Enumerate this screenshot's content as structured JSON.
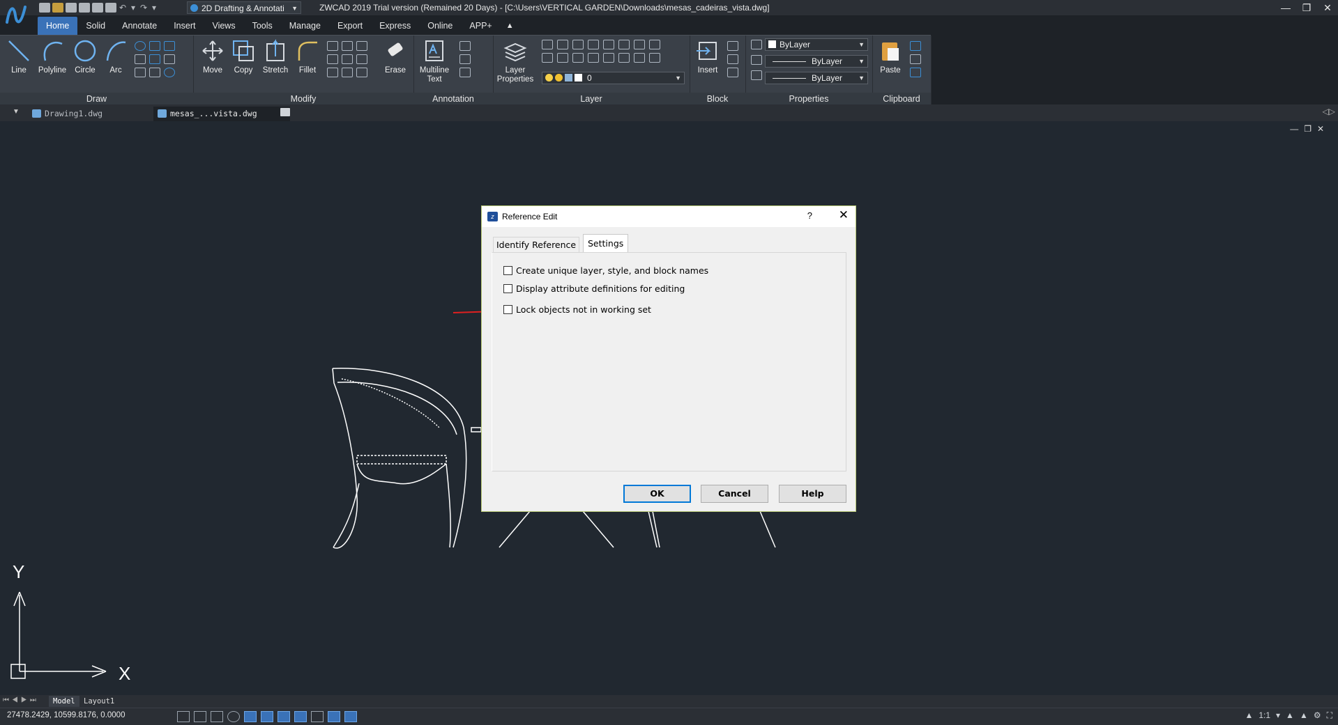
{
  "titlebar": {
    "workspace": "2D Drafting & Annotati",
    "window_title": "ZWCAD 2019 Trial version (Remained 20 Days) - [C:\\Users\\VERTICAL GARDEN\\Downloads\\mesas_cadeiras_vista.dwg]"
  },
  "ribbon_tabs": [
    "Home",
    "Solid",
    "Annotate",
    "Insert",
    "Views",
    "Tools",
    "Manage",
    "Export",
    "Express",
    "Online",
    "APP+"
  ],
  "ribbon": {
    "draw": {
      "title": "Draw",
      "line": "Line",
      "polyline": "Polyline",
      "circle": "Circle",
      "arc": "Arc"
    },
    "modify": {
      "title": "Modify",
      "move": "Move",
      "copy": "Copy",
      "stretch": "Stretch",
      "fillet": "Fillet",
      "erase": "Erase"
    },
    "annotation": {
      "title": "Annotation",
      "multiline_1": "Multiline",
      "multiline_2": "Text"
    },
    "layer": {
      "title": "Layer",
      "props_1": "Layer",
      "props_2": "Properties",
      "current_layer": "0"
    },
    "block": {
      "title": "Block",
      "insert": "Insert"
    },
    "properties": {
      "title": "Properties",
      "color": "ByLayer",
      "linetype": "ByLayer",
      "lineweight": "ByLayer"
    },
    "clipboard": {
      "title": "Clipboard",
      "paste": "Paste"
    }
  },
  "doc_tabs": [
    "Drawing1.dwg",
    "mesas_...vista.dwg"
  ],
  "layout_tabs": [
    "Model",
    "Layout1"
  ],
  "status": {
    "coords": "27478.2429, 10599.8176, 0.0000",
    "scale": "1:1"
  },
  "ucs": {
    "x": "X",
    "y": "Y"
  },
  "dialog": {
    "title": "Reference Edit",
    "help_glyph": "?",
    "tab_identify": "Identify Reference",
    "tab_settings": "Settings",
    "options": [
      {
        "label": "Create unique layer, style, and block names",
        "checked": false
      },
      {
        "label": "Display attribute definitions for editing",
        "checked": false
      },
      {
        "label": "Lock objects not in working set",
        "checked": false
      }
    ],
    "ok": "OK",
    "cancel": "Cancel",
    "help": "Help"
  },
  "colors": {
    "accent": "#3a72b8",
    "canvas": "#212830",
    "annotation_arrow": "#e02020"
  }
}
